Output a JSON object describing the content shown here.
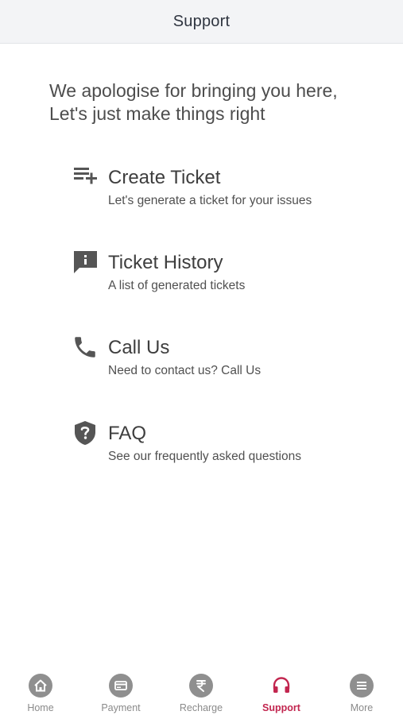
{
  "header": {
    "title": "Support"
  },
  "intro": {
    "line1": "We apologise for bringing you here,",
    "line2": "Let's just make things right"
  },
  "menu": [
    {
      "title": "Create Ticket",
      "subtitle": "Let's generate a ticket for your issues",
      "icon": "playlist-add-icon"
    },
    {
      "title": "Ticket History",
      "subtitle": "A list of generated tickets",
      "icon": "feedback-icon"
    },
    {
      "title": "Call Us",
      "subtitle": "Need to contact us? Call Us",
      "icon": "phone-icon"
    },
    {
      "title": "FAQ",
      "subtitle": "See our frequently asked questions",
      "icon": "shield-question-icon"
    }
  ],
  "tabbar": {
    "active": "Support",
    "active_color": "#c2264f",
    "inactive_color": "#8a8a8a",
    "items": [
      {
        "label": "Home",
        "icon": "home-icon"
      },
      {
        "label": "Payment",
        "icon": "card-icon"
      },
      {
        "label": "Recharge",
        "icon": "rupee-icon"
      },
      {
        "label": "Support",
        "icon": "headset-icon"
      },
      {
        "label": "More",
        "icon": "menu-icon"
      }
    ]
  }
}
